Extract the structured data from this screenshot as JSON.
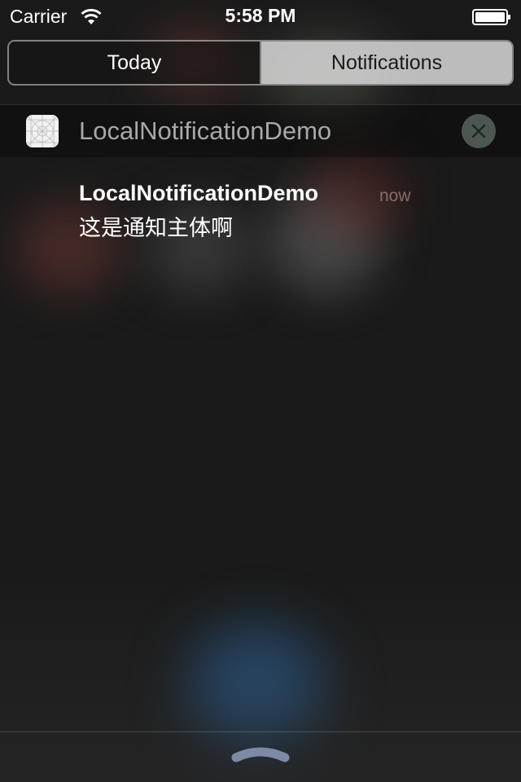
{
  "status_bar": {
    "carrier": "Carrier",
    "time": "5:58 PM",
    "wifi_icon": "wifi-icon",
    "battery_icon": "battery-icon"
  },
  "tabs": [
    {
      "label": "Today",
      "selected": false
    },
    {
      "label": "Notifications",
      "selected": true
    }
  ],
  "app_group": {
    "app_name": "LocalNotificationDemo",
    "app_icon": "app-grid-icon",
    "clear_icon": "close-icon"
  },
  "notification": {
    "title": "LocalNotificationDemo",
    "time": "now",
    "body": "这是通知主体啊"
  },
  "bottom": {
    "grabber_icon": "chevron-up-icon"
  },
  "colors": {
    "background": "#1b1b1b",
    "selected_tab_bg": "#e1e1e1",
    "app_name_text": "#a8a8a8",
    "timestamp_text": "#8a6a66",
    "grabber": "#7d8aa5"
  }
}
